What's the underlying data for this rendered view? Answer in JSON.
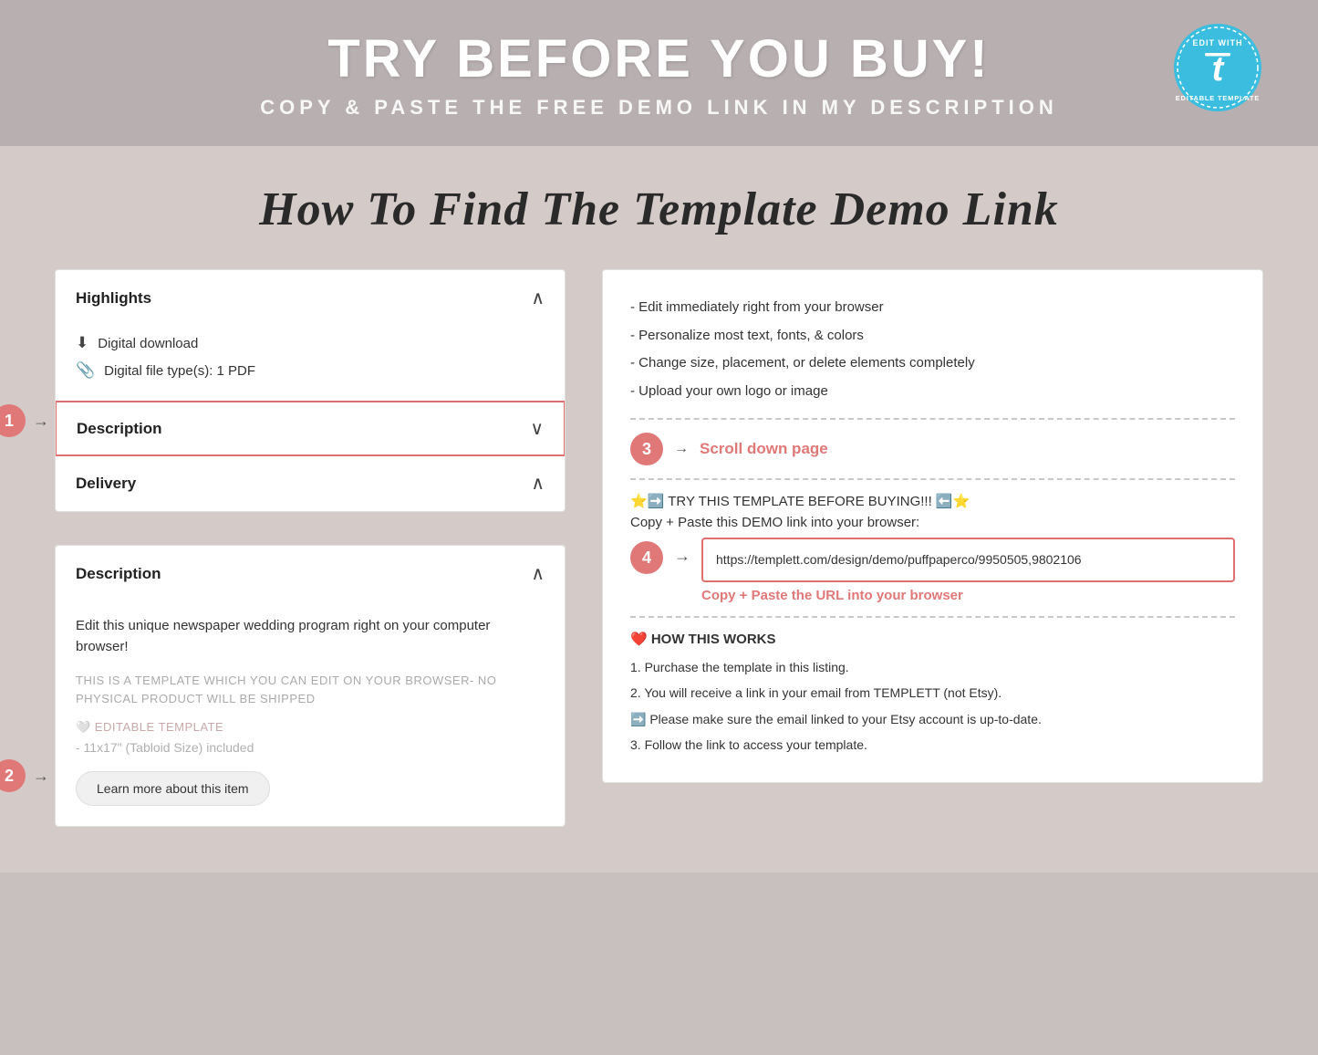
{
  "banner": {
    "title": "TRY BEFORE YOU BUY!",
    "subtitle": "COPY & PASTE THE FREE DEMO LINK IN MY DESCRIPTION"
  },
  "badge": {
    "line1": "EDIT WITH",
    "brand": "t",
    "line2": "EDITABLE TEMPLATE"
  },
  "section_title": "How To Find The Template Demo Link",
  "left_panel_top": {
    "highlights_label": "Highlights",
    "item1": "Digital download",
    "item2": "Digital file type(s): 1 PDF",
    "description_label": "Description",
    "delivery_label": "Delivery"
  },
  "left_panel_bottom": {
    "description_label": "Description",
    "main_text": "Edit this unique newspaper wedding program right on your computer browser!",
    "warning": "THIS IS A TEMPLATE WHICH YOU CAN EDIT ON YOUR BROWSER- NO PHYSICAL PRODUCT WILL BE SHIPPED",
    "editable_label": "🤍 EDITABLE TEMPLATE",
    "size_label": "- 11x17\" (Tabloid Size) included",
    "learn_more_btn": "Learn more about this item"
  },
  "steps": {
    "step1_num": "1",
    "step2_num": "2",
    "step3_num": "3",
    "step4_num": "4"
  },
  "right_panel": {
    "features": [
      "- Edit immediately right from your browser",
      "- Personalize most text, fonts, & colors",
      "- Change size, placement, or delete elements completely",
      "- Upload your own logo or image"
    ],
    "scroll_label": "Scroll down page",
    "try_template": "⭐➡️ TRY THIS TEMPLATE BEFORE BUYING!!! ⬅️⭐",
    "copy_paste_line": "Copy + Paste this DEMO link into your browser:",
    "url": "https://templett.com/design/demo/puffpaperco/9950505,9802106",
    "url_label": "Copy + Paste the URL into your browser",
    "how_works_title": "❤️ HOW THIS WORKS",
    "how_works_items": [
      "1. Purchase the template in this listing.",
      "2. You will receive a link in your email from TEMPLETT (not Etsy).",
      "➡️ Please make sure the email linked to your Etsy account is up-to-date.",
      "3. Follow the link to access your template."
    ]
  },
  "colors": {
    "accent_red": "#e07878",
    "banner_bg": "#b8b0b0",
    "main_bg": "#d4cac8",
    "badge_blue": "#3bbde0"
  }
}
